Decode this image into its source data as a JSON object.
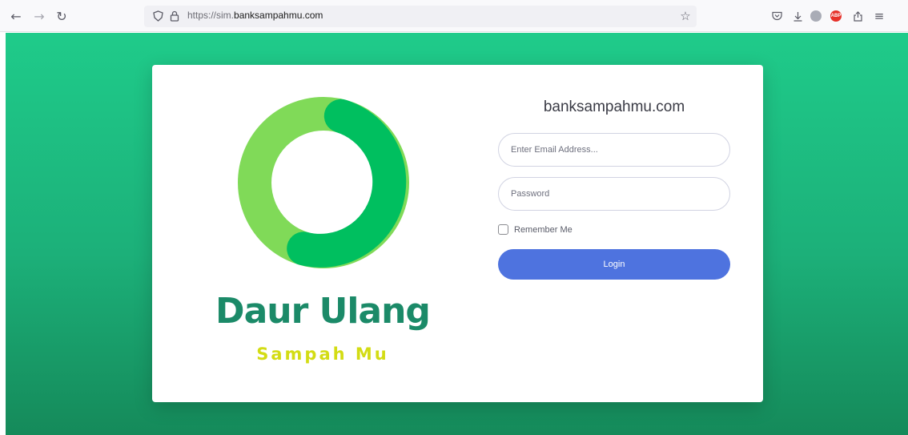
{
  "browser": {
    "url_scheme": "https://sim.",
    "url_domain": "banksampahmu.com",
    "icons": {
      "back": "←",
      "forward": "→",
      "reload": "↻",
      "shield": "◯",
      "lock": "🔒",
      "bookmark": "☆",
      "pocket": "⛉",
      "download": "⤓",
      "extension": "◉",
      "adblock": "ABP",
      "share": "⎋",
      "menu": "≡"
    }
  },
  "brand": {
    "title": "Daur Ulang",
    "subtitle": "Sampah Mu",
    "colors": {
      "title": "#1b8a68",
      "subtitle": "#d3dc14",
      "ring_light": "#80da58",
      "ring_dark": "#00bf5f"
    }
  },
  "login": {
    "heading": "banksampahmu.com",
    "email_placeholder": "Enter Email Address...",
    "password_placeholder": "Password",
    "remember_label": "Remember Me",
    "button_label": "Login",
    "accent": "#4e73df"
  }
}
